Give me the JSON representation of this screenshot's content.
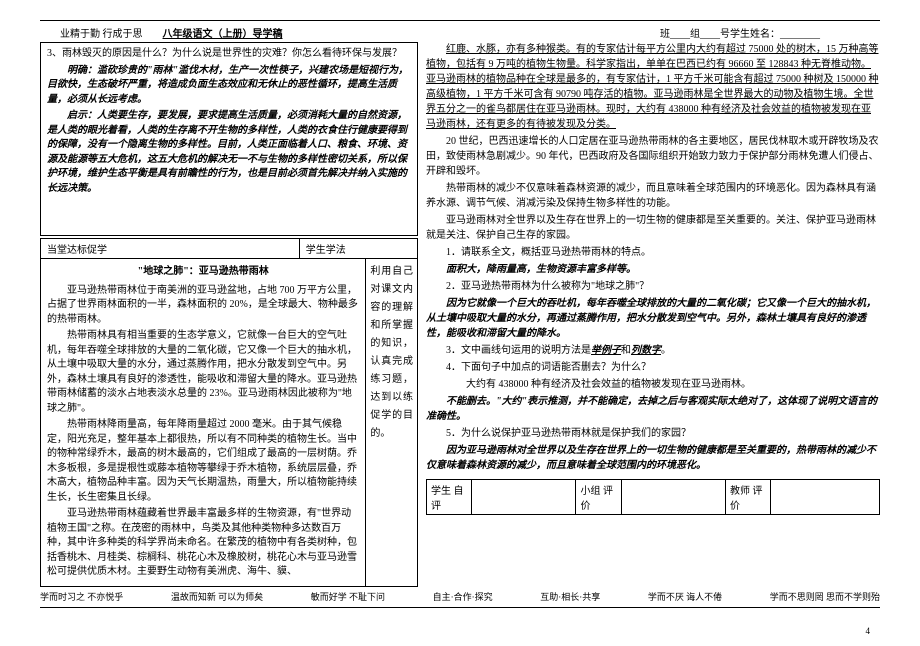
{
  "header": {
    "motto": "业精于勤  行成于思",
    "title": "八年级语文（上册）导学稿",
    "blanks": "班____组____号学生姓名：________"
  },
  "leftCol": {
    "question3": "3、雨林毁灭的原因是什么？为什么说是世界性的灾难？你怎么看待环保与发展？",
    "answer3": "明确：滥砍珍贵的\"雨林\"滥伐木材，生产一次性筷子，兴建农场是短视行为，目欲快，生态破坏严重，将造成负面生态效应和无休止的恶性循环，提高生活质量，必须从长远考虑。",
    "hint": "启示：人类要生存，要发展，要求提高生活质量，必须消耗大量的自然资源，是人类的眼光着看，人类的生存离不开生物的多样性，人类的衣食住行健康要得到的保障，没有一个隐离生物的多样性。目前，人类正面临着人口、粮食、环境、资源及能源等五大危机，这五大危机的解决无一不与生物的多样性密切关系，所以保护环境，维护生态平衡是具有前瞻性的行为，也是目前必须首先解决并纳入实施的长远决策。",
    "tableRow": {
      "left": "当堂达标促学",
      "right": "学生学法"
    },
    "article": {
      "title": "\"地球之肺\"：亚马逊热带雨林",
      "p1": "亚马逊热带雨林位于南美洲的亚马逊盆地，占地 700 万平方公里，占据了世界雨林面积的一半，森林面积的 20%，是全球最大、物种最多的热带雨林。",
      "p2": "热带雨林具有相当重要的生态学意义，它就像一台巨大的空气吐机，每年吞噬全球排放的大量的二氧化碳，它又像一个巨大的抽水机，从土壤中吸取大量的水分，通过蒸腾作用，把水分散发到空气中。另外，森林土壤具有良好的渗透性，能吸收和滞留大量的降水。亚马逊热带雨林储蓄的淡水占地表淡水总量的 23%。亚马逊雨林因此被称为\"地球之肺\"。",
      "p3": "热带雨林降雨量高，每年降雨量超过 2000 毫米。由于其气候稳定，阳光充足，整年基本上都很热，所以有不同种类的植物生长。当中的物种常绿乔木，最高的树木最高的，它们组成了最高的一层树荫。乔木多板根，多是提根性或藤本植物等攀绿于乔木植物，系统层层叠，乔木高大，植物品种丰富。因为天气长期温热，雨量大，所以植物能持续生长，长生密集且长绿。",
      "p4": "亚马逊热带雨林蕴藏着世界最丰富最多样的生物资源，有\"世界动植物王国\"之称。在茂密的雨林中，鸟类及其他种类物种多达数百万种，其中许多种类的科学界尚未命名。在繁茂的植物中有各类树种，包括香桃木、月桂类、棕榈科、桃花心木及橡胶树，桃花心木与亚马逊雪松可提供优质木材。主要野生动物有美洲虎、海牛、貘、",
      "side": "利用自己对课文内容的理解和所掌握的知识，认真完成练习题，达到以练促学的目的。"
    }
  },
  "rightCol": {
    "p1": "红鹿、水豚，亦有多种猴类。有的专家估计每平方公里内大约有超过 75000 处的树木，15 万种高等植物，包括有 9 万吨的植物生物量。科学家指出，单单在巴西已约有 96660 至 128843 种无脊椎动物。亚马逊雨林的植物品种在全球是最多的，有专家估计，1 平方千米可能含有超过 75000 种树及 150000 种高级植物，1 平方千米可含有 90790 吨存活的植物。亚马逊雨林是全世界最大的动物及植物生境。全世界五分之一的雀鸟都居住在亚马逊雨林。现时，大约有 438000 种有经济及社会效益的植物被发现在亚马逊雨林，还有更多的有待被发现及分类。",
    "p2": "20 世纪，巴西迅速增长的人口定居在亚马逊热带雨林的各主要地区，居民伐林取木或开辟牧场及农田，致使雨林急剧减少。90 年代，巴西政府及各国际组织开始致力致力于保护部分雨林免遭人们侵占、开辟和毁坏。",
    "p3": "热带雨林的减少不仅意味着森林资源的减少，而且意味着全球范围内的环境恶化。因为森林具有涵养水源、调节气候、消减污染及保持生物多样性的功能。",
    "p4": "亚马逊雨林对全世界以及生存在世界上的一切生物的健康都是至关重要的。关注、保护亚马逊雨林就是关注、保护自己生存的家园。",
    "q1": "1．请联系全文，概括亚马逊热带雨林的特点。",
    "a1": "面积大，降雨量高，生物资源丰富多样等。",
    "q2": "2．亚马逊热带雨林为什么被称为\"地球之肺\"？",
    "a2": "因为它就像一个巨大的吞吐机，每年吞噬全球排放的大量的二氧化碳；它又像一个巨大的抽水机，从土壤中吸取大量的水分，再通过蒸腾作用，把水分散发到空气中。另外，森林土壤具有良好的渗透性，能吸收和滞留大量的降水。",
    "q3": "3．文中画线句运用的说明方法是举例子和列数字。",
    "q4": "4．下面句子中加点的词语能否删去？为什么？",
    "q4b": "大约有 438000 种有经济及社会效益的植物被发现在亚马逊雨林。",
    "a4": "不能删去。\"大约\"表示推测，并不能确定，去掉之后与客观实际太绝对了，这体现了说明文语言的准确性。",
    "q5": "5．为什么说保护亚马逊热带雨林就是保护我们的家园？",
    "a5": "因为亚马逊雨林对全世界以及生存在世界上的一切生物的健康都是至关重要的，热带雨林的减少不仅意味着森林资源的减少，而且意味着全球范围内的环境恶化。"
  },
  "evalTable": {
    "c1": "学生\n自评",
    "c2": "小组\n评价",
    "c3": "教师\n评价"
  },
  "footer": {
    "l1": "学而时习之  不亦悦乎",
    "l2": "温故而知新  可以为师矣",
    "l3": "敏而好学  不耻下问",
    "l4": "自主·合作·探究",
    "l5": "互助·相长·共享",
    "l6": "学而不厌  诲人不倦",
    "l7": "学而不思则罔  思而不学则殆"
  },
  "pageNum": "4"
}
